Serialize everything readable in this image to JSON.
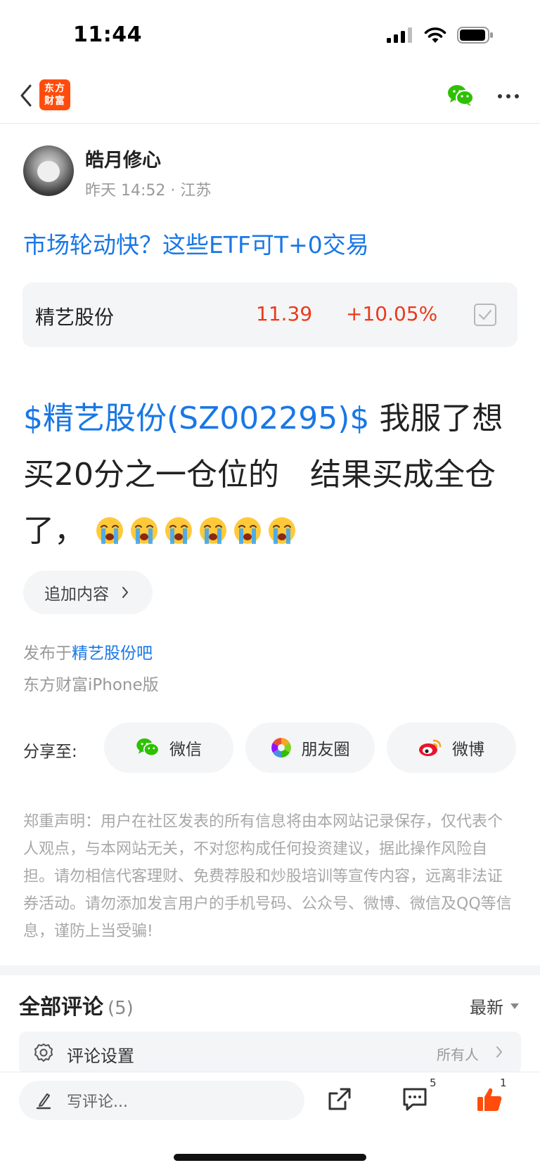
{
  "status_bar": {
    "time": "11:44"
  },
  "nav": {
    "logo_line1": "东方",
    "logo_line2": "财富"
  },
  "author": {
    "name": "皓月修心",
    "meta": "昨天 14:52 · 江苏"
  },
  "post": {
    "title": "市场轮动快？这些ETF可T+0交易",
    "stock_link": "$精艺股份(SZ002295)$",
    "body_text": "我服了想买20分之一仓位的　结果买成全仓了，",
    "emoji_count": 6,
    "emoji_name": "crying-face-emoji"
  },
  "stock_card": {
    "name": "精艺股份",
    "price": "11.39",
    "change": "+10.05%",
    "color": "#ea3a1a"
  },
  "append_button": {
    "label": "追加内容"
  },
  "published": {
    "prefix": "发布于",
    "bar_name": "精艺股份吧",
    "client": "东方财富iPhone版"
  },
  "share": {
    "label": "分享至:",
    "targets": [
      {
        "label": "微信",
        "icon": "wechat-icon"
      },
      {
        "label": "朋友圈",
        "icon": "moments-icon"
      },
      {
        "label": "微博",
        "icon": "weibo-icon"
      }
    ]
  },
  "disclaimer": "郑重声明：用户在社区发表的所有信息将由本网站记录保存，仅代表个人观点，与本网站无关，不对您构成任何投资建议，据此操作风险自担。请勿相信代客理财、免费荐股和炒股培训等宣传内容，远离非法证券活动。请勿添加发言用户的手机号码、公众号、微博、微信及QQ等信息，谨防上当受骗!",
  "comments": {
    "title": "全部评论",
    "count": "(5)",
    "sort_label": "最新",
    "settings_label": "评论设置",
    "settings_value": "所有人"
  },
  "bottom_bar": {
    "input_placeholder": "写评论...",
    "comment_badge": "5",
    "like_badge": "1"
  },
  "colors": {
    "link_blue": "#1977e6",
    "up_red": "#ea3a1a",
    "brand_orange": "#ff4c0c",
    "wechat_green": "#2dc100"
  }
}
